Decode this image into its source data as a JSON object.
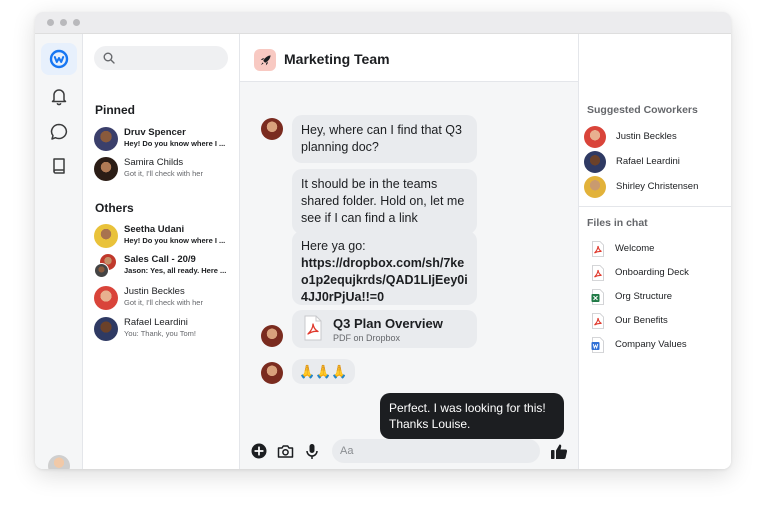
{
  "window": {
    "controls": [
      "close",
      "minimize",
      "maximize"
    ]
  },
  "rail": {
    "items": [
      {
        "name": "workplace-logo-icon",
        "active": true
      },
      {
        "name": "bell-icon",
        "active": false
      },
      {
        "name": "chat-bubble-icon",
        "active": false
      },
      {
        "name": "book-icon",
        "active": false
      }
    ],
    "status": "online"
  },
  "search": {
    "placeholder": ""
  },
  "pinned": {
    "title": "Pinned",
    "contacts": [
      {
        "name": "Druv Spencer",
        "preview": "Hey! Do you know where I ...",
        "unread": true
      },
      {
        "name": "Samira Childs",
        "preview": "Got it, I'll check with her",
        "unread": false
      }
    ]
  },
  "others": {
    "title": "Others",
    "contacts": [
      {
        "name": "Seetha Udani",
        "preview": "Hey! Do you know where I ...",
        "unread": true
      },
      {
        "name": "Sales Call - 20/9",
        "preview": "Jason: Yes, all ready. Here ...",
        "unread": true
      },
      {
        "name": "Justin Beckles",
        "preview": "Got it, I'll check with her",
        "unread": false
      },
      {
        "name": "Rafael Leardini",
        "preview": "You: Thank, you Tom!",
        "unread": false
      }
    ]
  },
  "chat": {
    "title": "Marketing Team",
    "messages": [
      {
        "text": "Hey, where can I find that Q3 planning doc?"
      },
      {
        "text": "It should be in the teams shared folder. Hold on, let me see if I can find a link"
      },
      {
        "prefix": "Here ya go:",
        "link": "https://dropbox.com/sh/7keo1p2equjkrds/QAD1LIjEey0i4JJ0rPjUa!!=0"
      },
      {
        "file_name": "Q3 Plan Overview",
        "file_source": "PDF on Dropbox"
      },
      {
        "text": "🙏🙏🙏"
      },
      {
        "text": "Perfect. I was looking for this! Thanks Louise."
      }
    ],
    "composer": {
      "placeholder": "Aa"
    }
  },
  "suggested": {
    "title": "Suggested Coworkers",
    "people": [
      "Justin Beckles",
      "Rafael Leardini",
      "Shirley Christensen"
    ]
  },
  "files": {
    "title": "Files in chat",
    "items": [
      {
        "name": "Welcome",
        "kind": "pdf"
      },
      {
        "name": "Onboarding Deck",
        "kind": "pdf"
      },
      {
        "name": "Org Structure",
        "kind": "excel"
      },
      {
        "name": "Our Benefits",
        "kind": "pdf"
      },
      {
        "name": "Company Values",
        "kind": "doc"
      }
    ]
  },
  "colors": {
    "accent": "#1877f2",
    "pdf_red": "#e03a2e",
    "excel_green": "#1f7a45",
    "doc_blue": "#2f6fd6",
    "my_bubble": "#1c1e21",
    "other_bubble": "#e9ebee",
    "online": "#31a24c"
  }
}
